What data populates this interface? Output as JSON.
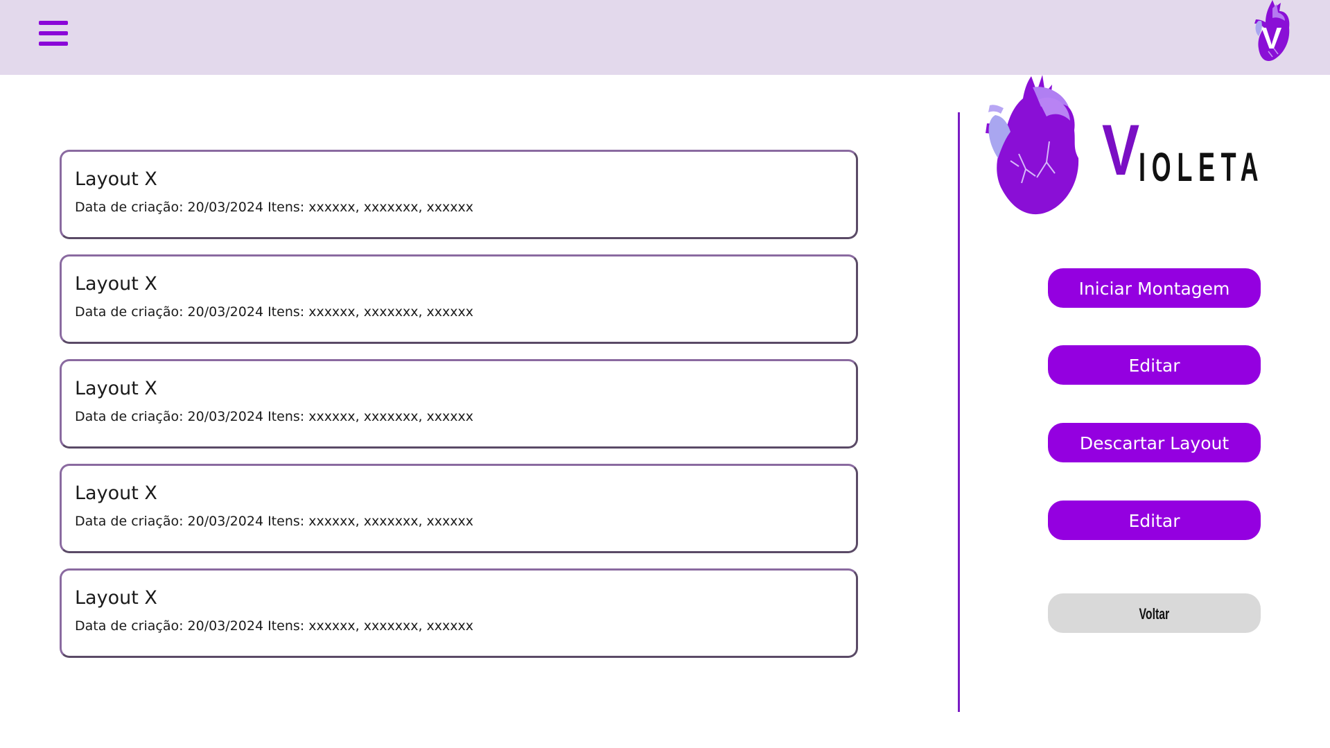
{
  "header": {
    "menu_icon": "hamburger-menu-icon",
    "logo_icon": "heart-v-logo-icon"
  },
  "layouts": [
    {
      "title": "Layout X",
      "meta": "Data de criação: 20/03/2024 Itens: xxxxxx, xxxxxxx, xxxxxx"
    },
    {
      "title": "Layout X",
      "meta": "Data de criação: 20/03/2024 Itens: xxxxxx, xxxxxxx, xxxxxx"
    },
    {
      "title": "Layout X",
      "meta": "Data de criação: 20/03/2024 Itens: xxxxxx, xxxxxxx, xxxxxx"
    },
    {
      "title": "Layout X",
      "meta": "Data de criação: 20/03/2024 Itens: xxxxxx, xxxxxxx, xxxxxx"
    },
    {
      "title": "Layout X",
      "meta": "Data de criação: 20/03/2024 Itens: xxxxxx, xxxxxxx, xxxxxx"
    }
  ],
  "brand": {
    "initial": "V",
    "rest": "IOLETA",
    "icon": "anatomical-heart-icon"
  },
  "actions": {
    "start": "Iniciar Montagem",
    "edit": "Editar",
    "discard": "Descartar Layout",
    "edit2": "Editar",
    "back": "Voltar"
  },
  "colors": {
    "header_bg": "#e3d9ec",
    "accent": "#9400e0",
    "back_button": "#d9d9d9"
  }
}
